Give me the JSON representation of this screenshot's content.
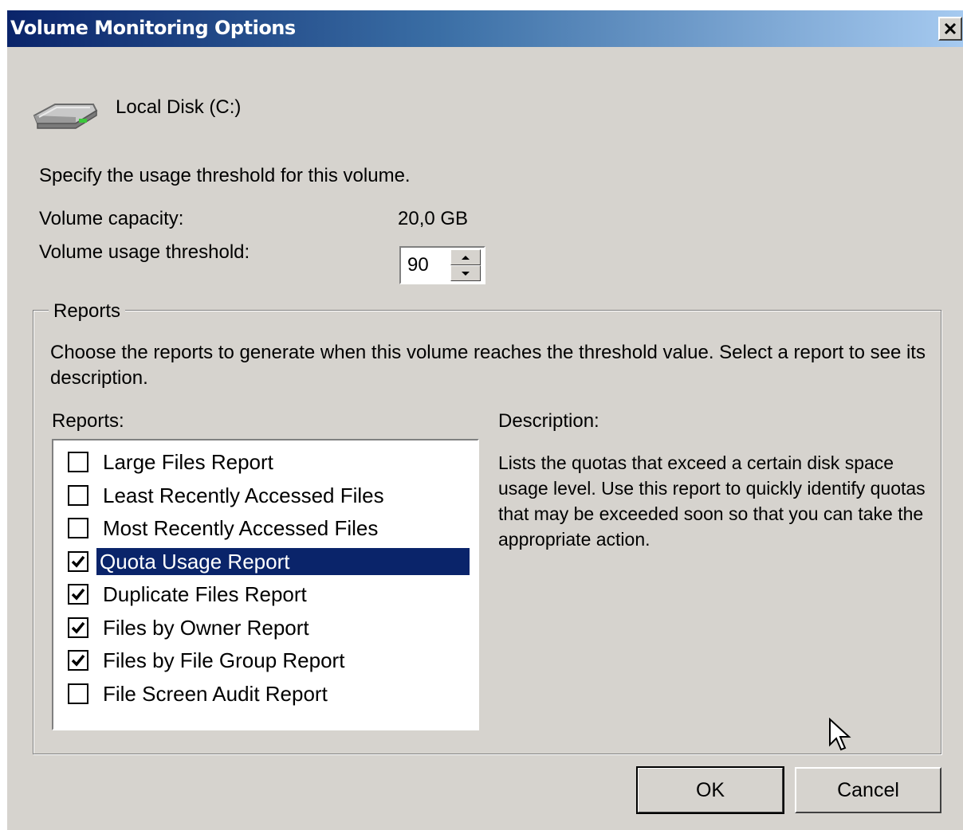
{
  "window": {
    "title": "Volume Monitoring Options",
    "close_label": "✕"
  },
  "volume": {
    "icon": "disk-drive-icon",
    "name": "Local Disk (C:)"
  },
  "instructions": "Specify the usage threshold for this volume.",
  "capacity": {
    "label": "Volume capacity:",
    "value": "20,0 GB"
  },
  "threshold": {
    "label": "Volume usage threshold:",
    "value": "90"
  },
  "reports_group": {
    "title": "Reports",
    "instructions": "Choose the reports to generate when this volume reaches the threshold value. Select a report to see its description.",
    "list_label": "Reports:",
    "items": [
      {
        "label": "Large Files Report",
        "checked": false,
        "selected": false
      },
      {
        "label": "Least Recently Accessed Files",
        "checked": false,
        "selected": false
      },
      {
        "label": "Most Recently Accessed Files",
        "checked": false,
        "selected": false
      },
      {
        "label": "Quota Usage Report",
        "checked": true,
        "selected": true
      },
      {
        "label": "Duplicate Files Report",
        "checked": true,
        "selected": false
      },
      {
        "label": "Files by Owner Report",
        "checked": true,
        "selected": false
      },
      {
        "label": "Files by File Group Report",
        "checked": true,
        "selected": false
      },
      {
        "label": "File Screen Audit Report",
        "checked": false,
        "selected": false
      }
    ],
    "description_label": "Description:",
    "description": "Lists the quotas that exceed a certain disk space usage level. Use this report to quickly identify quotas that may be exceeded soon so that you can take the appropriate action."
  },
  "buttons": {
    "ok": "OK",
    "cancel": "Cancel"
  },
  "colors": {
    "title_start": "#0a246a",
    "title_end": "#a6caf0",
    "dialog_bg": "#d6d3ce",
    "selection": "#0a246a"
  }
}
